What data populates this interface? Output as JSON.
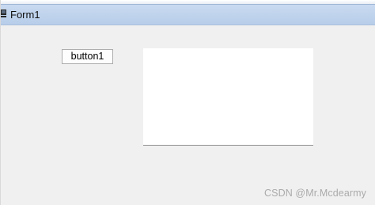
{
  "window": {
    "title": "Form1",
    "icon": "form-window-icon"
  },
  "form": {
    "button_label": "button1",
    "panel": "white content panel"
  },
  "watermark": {
    "text": "CSDN @Mr.Mcdearmy"
  },
  "colors": {
    "titlebar": "#b7cde9",
    "form_background": "#f0f0f0",
    "panel_background": "#ffffff"
  }
}
